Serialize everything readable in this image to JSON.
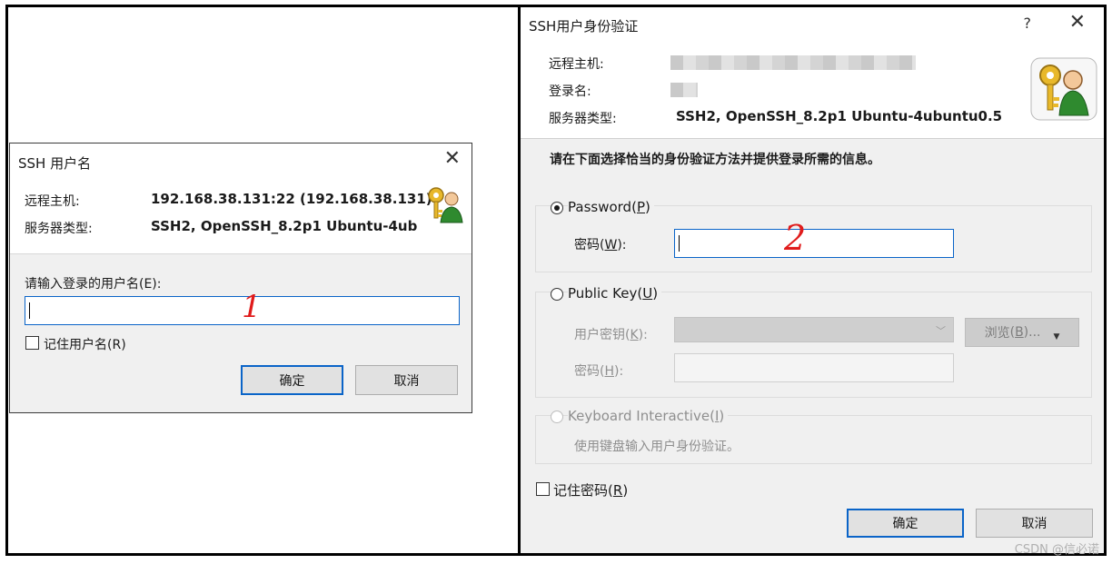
{
  "dialog_username": {
    "title": "SSH 用户名",
    "close": "✕",
    "remote_host_label": "远程主机:",
    "remote_host_value": "192.168.38.131:22 (192.168.38.131)",
    "server_type_label": "服务器类型:",
    "server_type_value": "SSH2, OpenSSH_8.2p1 Ubuntu-4ub",
    "prompt": "请输入登录的用户名(E):",
    "input_value": "",
    "remember_label": "记住用户名(R)",
    "remember_checked": false,
    "ok_label": "确定",
    "cancel_label": "取消",
    "annotation": "1"
  },
  "dialog_auth": {
    "title": "SSH用户身份验证",
    "help": "?",
    "close": "✕",
    "remote_host_label": "远程主机:",
    "login_name_label": "登录名:",
    "server_type_label": "服务器类型:",
    "server_type_value": "SSH2, OpenSSH_8.2p1 Ubuntu-4ubuntu0.5",
    "instruction": "请在下面选择恰当的身份验证方法并提供登录所需的信息。",
    "password_option": {
      "label": "Password",
      "key": "P",
      "selected": true
    },
    "password_field_label": "密码",
    "password_field_key": "W",
    "password_value": "",
    "publickey_option": {
      "label": "Public Key",
      "key": "U",
      "selected": false
    },
    "user_key_label": "用户密钥",
    "user_key_key": "K",
    "browse_label": "浏览",
    "browse_key": "B",
    "passphrase_label": "密码",
    "passphrase_key": "H",
    "keyboard_option": {
      "label": "Keyboard Interactive",
      "key": "I",
      "selected": false
    },
    "keyboard_desc": "使用键盘输入用户身份验证。",
    "remember_label": "记住密码",
    "remember_key": "R",
    "remember_checked": false,
    "ok_label": "确定",
    "cancel_label": "取消",
    "annotation": "2"
  },
  "watermark": "CSDN @信必诺",
  "colors": {
    "accent": "#0a64c8",
    "annotation": "#e01b1b",
    "dialog_bg": "#f0f0f0"
  },
  "icons": {
    "user_key": "user-key-icon"
  }
}
